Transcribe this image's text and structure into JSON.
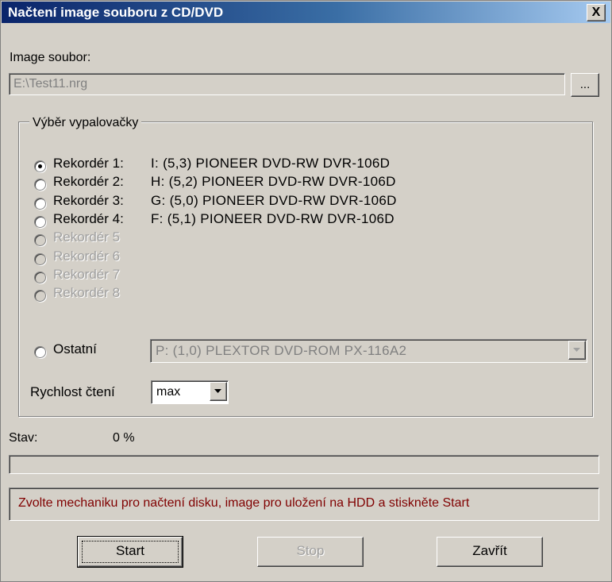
{
  "window": {
    "title": "Načtení image souboru z CD/DVD",
    "close_label": "X"
  },
  "image": {
    "label": "Image soubor:",
    "value": "E:\\Test11.nrg",
    "browse_label": "..."
  },
  "burner": {
    "group_label": "Výběr vypalovačky",
    "recorders": [
      {
        "label": "Rekordér 1:",
        "drive": "I:  (5,3)  PIONEER  DVD-RW  DVR-106D",
        "selected": true,
        "enabled": true
      },
      {
        "label": "Rekordér 2:",
        "drive": "H:  (5,2)  PIONEER  DVD-RW  DVR-106D",
        "selected": false,
        "enabled": true
      },
      {
        "label": "Rekordér 3:",
        "drive": "G:  (5,0)  PIONEER  DVD-RW  DVR-106D",
        "selected": false,
        "enabled": true
      },
      {
        "label": "Rekordér 4:",
        "drive": "F:  (5,1)  PIONEER  DVD-RW  DVR-106D",
        "selected": false,
        "enabled": true
      },
      {
        "label": "Rekordér 5",
        "selected": false,
        "enabled": false
      },
      {
        "label": "Rekordér 6",
        "selected": false,
        "enabled": false
      },
      {
        "label": "Rekordér 7",
        "selected": false,
        "enabled": false
      },
      {
        "label": "Rekordér 8",
        "selected": false,
        "enabled": false
      }
    ],
    "other": {
      "label": "Ostatní",
      "value": "P:  (1,0)  PLEXTOR  DVD-ROM PX-116A2"
    },
    "speed": {
      "label": "Rychlost čtení",
      "value": "max"
    }
  },
  "status": {
    "label": "Stav:",
    "percent_text": "0 %",
    "progress": 0
  },
  "message": {
    "text": "Zvolte mechaniku pro načtení disku, image pro uložení na HDD a stiskněte Start",
    "color": "#800000"
  },
  "buttons": {
    "start": "Start",
    "stop": "Stop",
    "close": "Zavřít"
  },
  "icons": {
    "close": "close-icon",
    "dropdown": "chevron-down-icon"
  }
}
